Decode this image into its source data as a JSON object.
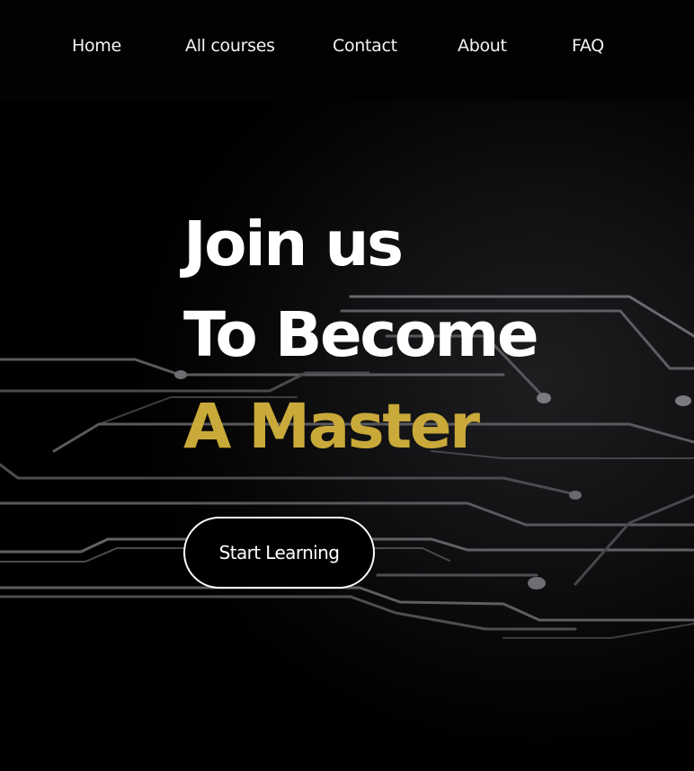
{
  "nav": {
    "items": [
      {
        "label": "Home"
      },
      {
        "label": "All courses"
      },
      {
        "label": "Contact"
      },
      {
        "label": "About"
      },
      {
        "label": "FAQ"
      }
    ]
  },
  "hero": {
    "line1": "Join us",
    "line2": "To Become",
    "line3": "A Master",
    "cta_label": "Start Learning",
    "background": "circuit-board-image"
  },
  "colors": {
    "background": "#000000",
    "text": "#ffffff",
    "accent": "#c9a93a"
  }
}
